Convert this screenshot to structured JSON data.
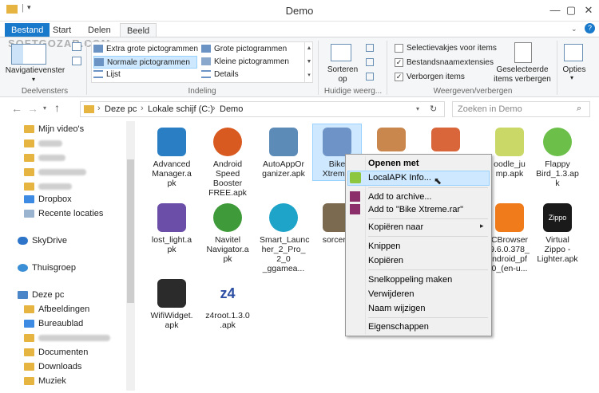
{
  "window": {
    "title": "Demo",
    "controls": [
      "—",
      "▢",
      "✕"
    ]
  },
  "tabs": [
    "Bestand",
    "Start",
    "Delen",
    "Beeld"
  ],
  "watermark": "SOFTGOZAR.COM",
  "ribbon": {
    "navpane_label": "Navigatievenster",
    "group1": "Deelvensters",
    "layout_items": [
      "Extra grote pictogrammen",
      "Grote pictogrammen",
      "Normale pictogrammen",
      "Kleine pictogrammen",
      "Lijst",
      "Details"
    ],
    "group2": "Indeling",
    "sort_label": "Sorteren",
    "sort_label2": "op",
    "group3": "Huidige weerg...",
    "checks": [
      "Selectievakjes voor items",
      "Bestandsnaamextensies",
      "Verborgen items"
    ],
    "checked": [
      false,
      true,
      true
    ],
    "hide_sel1": "Geselecteerde",
    "hide_sel2": "items verbergen",
    "group4": "Weergeven/verbergen",
    "options": "Opties"
  },
  "address": {
    "parts": [
      "Deze pc",
      "Lokale schijf (C:)",
      "Demo"
    ],
    "search_placeholder": "Zoeken in Demo"
  },
  "nav": {
    "items": [
      "Mijn video's",
      "Dropbox",
      "Recente locaties",
      "SkyDrive",
      "Thuisgroep",
      "Deze pc",
      "Afbeeldingen",
      "Bureaublad",
      "Documenten",
      "Downloads",
      "Muziek"
    ]
  },
  "files": [
    [
      "Advanced",
      "Manager.a",
      "pk"
    ],
    [
      "Android",
      "Speed",
      "Booster",
      "FREE.apk"
    ],
    [
      "AutoAppOr",
      "ganizer.apk"
    ],
    [
      "Bike",
      "Xtreme."
    ],
    [
      "",
      "",
      ""
    ],
    [
      "",
      "",
      ""
    ],
    [
      "oodle_ju",
      "mp.apk"
    ],
    [
      "Flappy",
      "Bird_1.3.ap",
      "k"
    ],
    [
      "lost_light.a",
      "pk"
    ],
    [
      "Navitel",
      "Navigator.a",
      "pk"
    ],
    [
      "Smart_Launc",
      "her_2_Pro_",
      "2_0",
      "_ggamea..."
    ],
    [
      "sorcery."
    ],
    [
      "CBrowser",
      "9.6.0.378_",
      "ndroid_pf",
      "0_(en-u..."
    ],
    [
      "Zippo",
      "Virtual",
      "Zippo -",
      "Lighter.apk"
    ],
    [
      "WifiWidget.",
      "apk"
    ],
    [
      "z4root.1.3.0",
      ".apk"
    ]
  ],
  "menu": {
    "items": [
      "Openen met",
      "LocalAPK Info...",
      "Add to archive...",
      "Add to \"Bike Xtreme.rar\"",
      "Kopiëren naar",
      "Knippen",
      "Kopiëren",
      "Snelkoppeling maken",
      "Verwijderen",
      "Naam wijzigen",
      "Eigenschappen"
    ]
  },
  "colors": {
    "accent": "#1979ca",
    "hover": "#cde8ff"
  }
}
